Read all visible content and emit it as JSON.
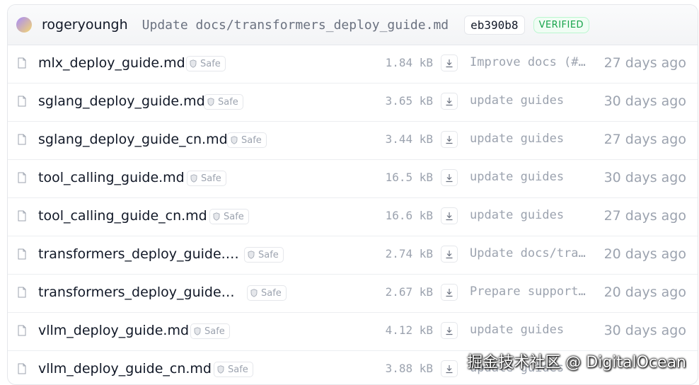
{
  "commit": {
    "author": "rogeryoungh",
    "message": "Update docs/transformers_deploy_guide.md",
    "hash": "eb390b8",
    "verified_label": "VERIFIED"
  },
  "safe_label": "Safe",
  "files": [
    {
      "name": "mlx_deploy_guide.md",
      "size": "1.84 kB",
      "message": "Improve docs (#…",
      "date": "27 days ago"
    },
    {
      "name": "sglang_deploy_guide.md",
      "size": "3.65 kB",
      "message": "update guides",
      "date": "30 days ago"
    },
    {
      "name": "sglang_deploy_guide_cn.md",
      "size": "3.44 kB",
      "message": "update guides",
      "date": "27 days ago"
    },
    {
      "name": "tool_calling_guide.md",
      "size": "16.5 kB",
      "message": "update guides",
      "date": "30 days ago"
    },
    {
      "name": "tool_calling_guide_cn.md",
      "size": "16.6 kB",
      "message": "update guides",
      "date": "27 days ago"
    },
    {
      "name": "transformers_deploy_guide.md",
      "size": "2.74 kB",
      "message": "Update docs/tra…",
      "date": "20 days ago"
    },
    {
      "name": "transformers_deploy_guide_…",
      "size": "2.67 kB",
      "message": "Prepare support…",
      "date": "20 days ago"
    },
    {
      "name": "vllm_deploy_guide.md",
      "size": "4.12 kB",
      "message": "update guides",
      "date": "30 days ago"
    },
    {
      "name": "vllm_deploy_guide_cn.md",
      "size": "3.88 kB",
      "message": "update guides",
      "date": ""
    }
  ],
  "watermark": "掘金技术社区 @ DigitalOcean",
  "icons": {
    "file": "file-icon",
    "shield": "shield-icon",
    "download": "download-icon"
  },
  "colors": {
    "verified": "#16a34a",
    "muted": "#9ca3af"
  }
}
